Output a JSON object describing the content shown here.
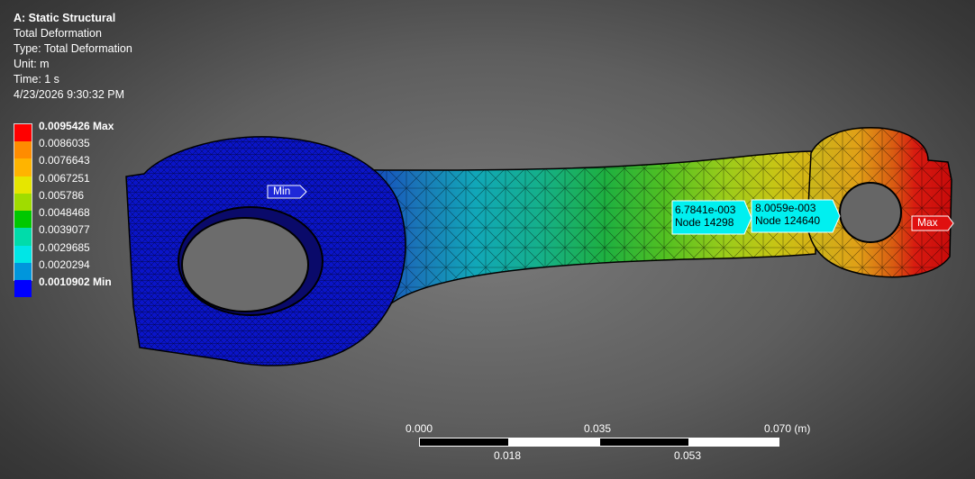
{
  "header": {
    "analysis": "A: Static Structural",
    "result": "Total Deformation",
    "type": "Type: Total Deformation",
    "unit": "Unit: m",
    "time": "Time: 1 s",
    "date": "4/23/2026 9:30:32 PM"
  },
  "legend": {
    "labels": [
      "0.0095426 Max",
      "0.0086035",
      "0.0076643",
      "0.0067251",
      "0.005786",
      "0.0048468",
      "0.0039077",
      "0.0029685",
      "0.0020294",
      "0.0010902 Min"
    ],
    "colors": [
      "#ff0000",
      "#ff8c00",
      "#ffb400",
      "#e6e600",
      "#a0dc00",
      "#00c800",
      "#00dcaa",
      "#00e6e6",
      "#0096dc",
      "#0000ff"
    ]
  },
  "probes": {
    "min_tag": "Min",
    "max_tag": "Max",
    "probe1_value": "6.7841e-003",
    "probe1_node": "Node 14298",
    "probe2_value": "8.0059e-003",
    "probe2_node": "Node 124640"
  },
  "scale_bar": {
    "top_labels": [
      "0.000",
      "0.035",
      "0.070 (m)"
    ],
    "bottom_labels": [
      "0.018",
      "0.053"
    ]
  }
}
